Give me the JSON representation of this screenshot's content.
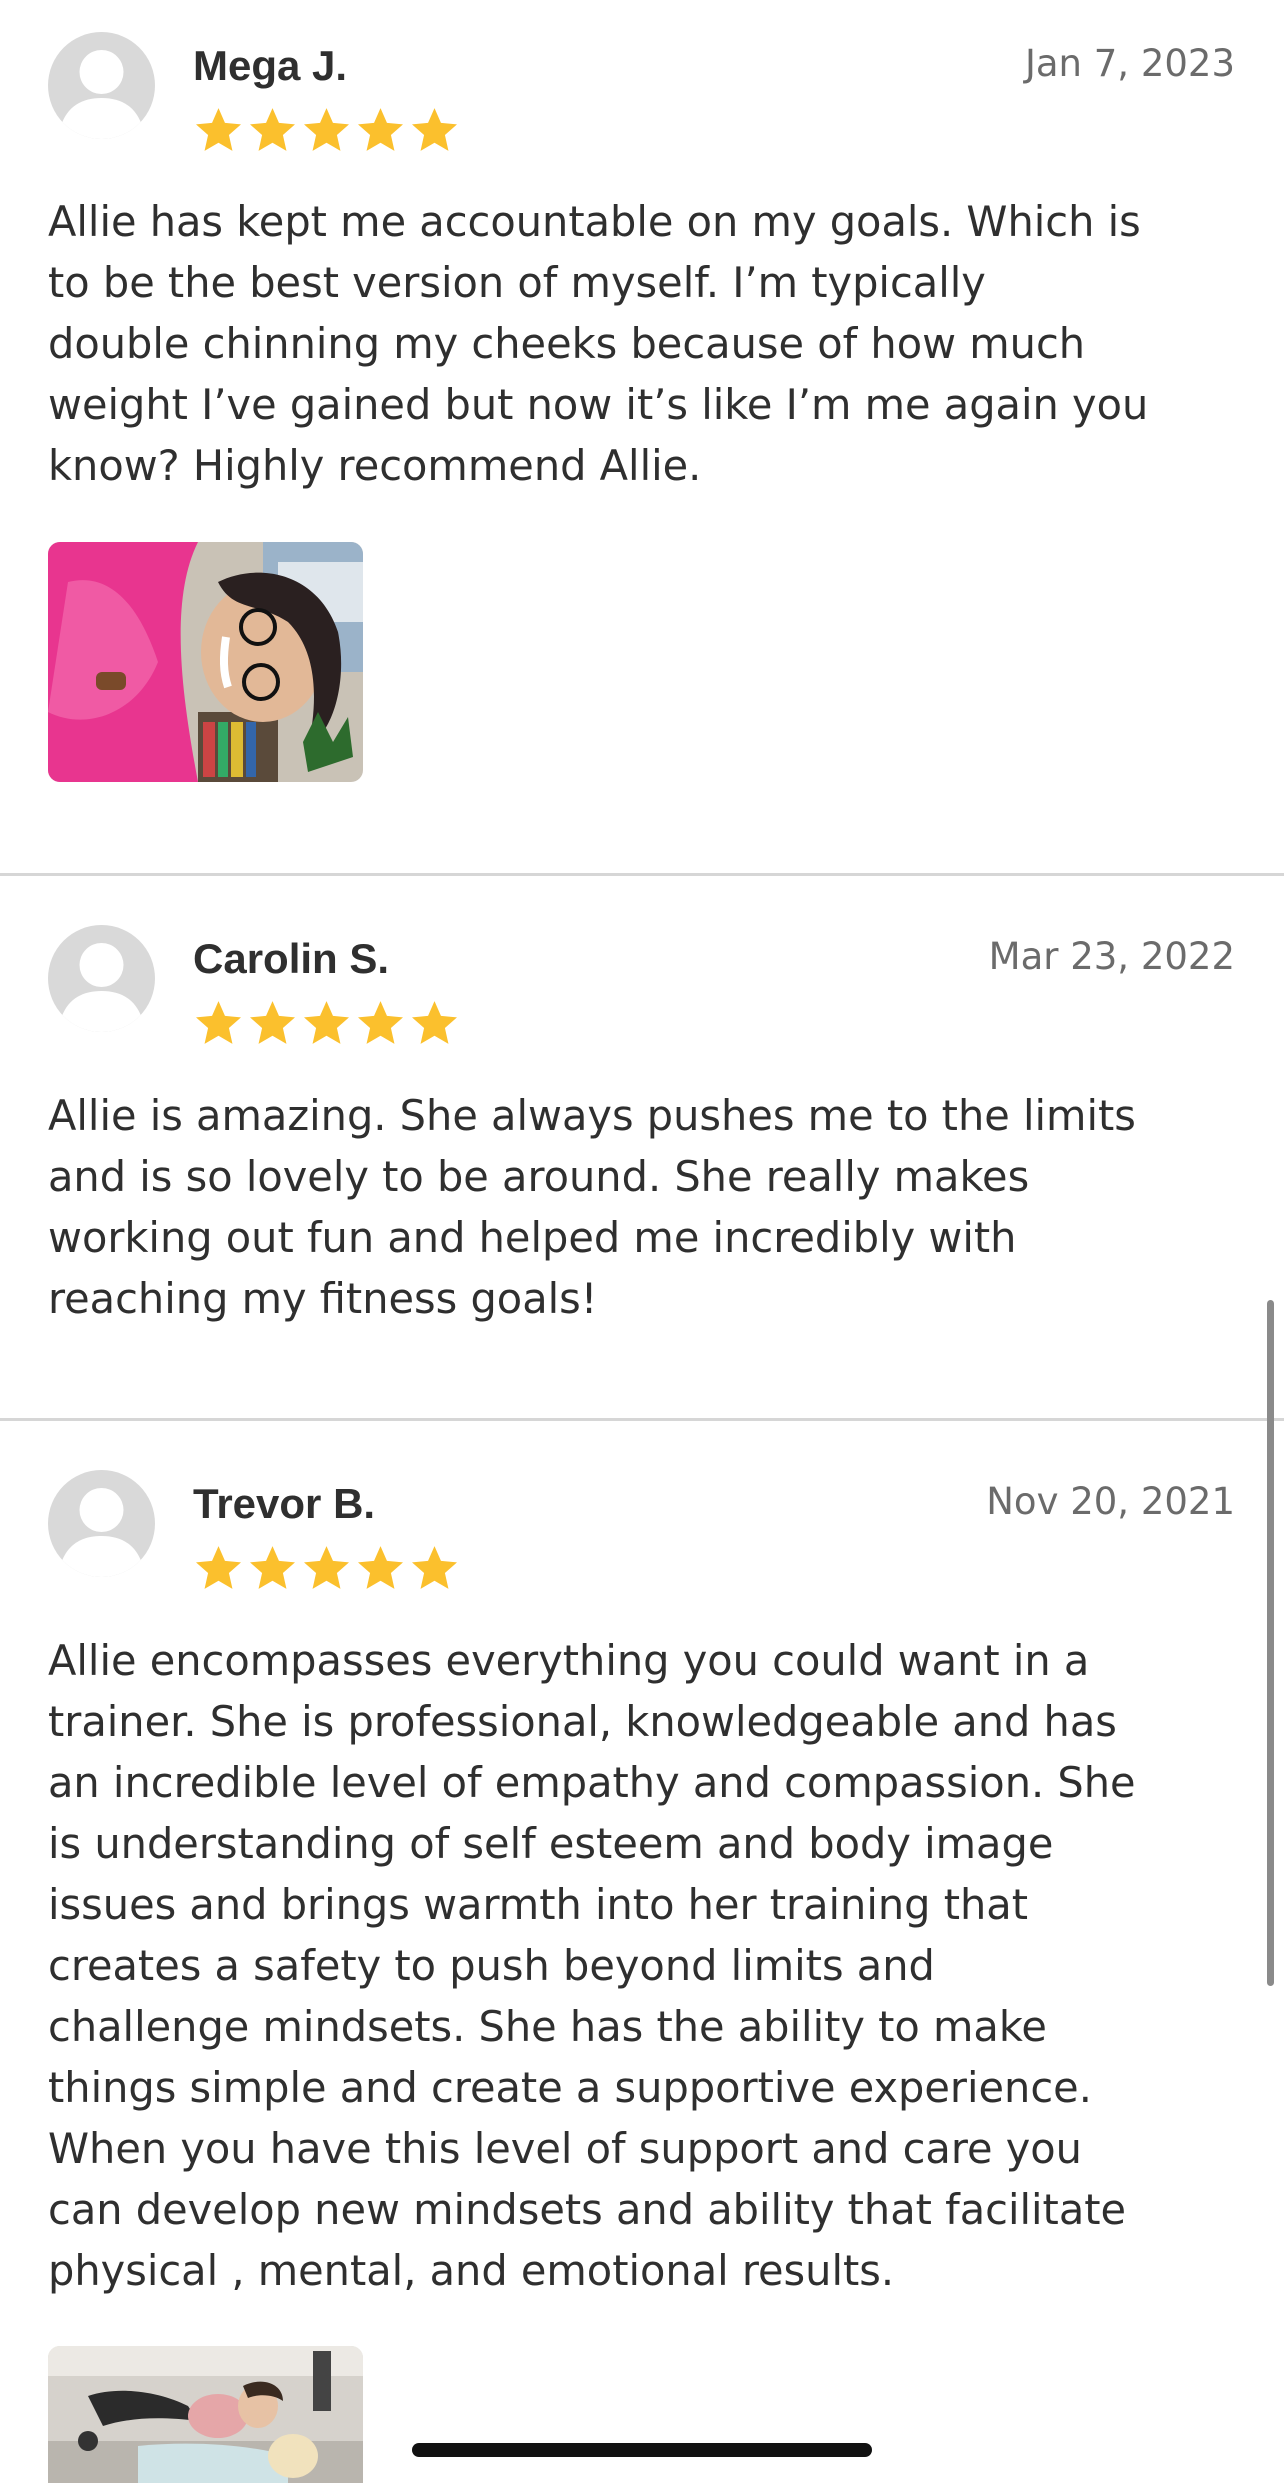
{
  "colors": {
    "star": "#FBC02D",
    "avatar_bg": "#d9d9d9",
    "divider": "#d6d6d6",
    "text": "#2f2f2f",
    "date": "#6b6b6b"
  },
  "reviews": [
    {
      "name": "Mega J.",
      "date": "Jan 7, 2023",
      "rating": 5,
      "text": "Allie has kept me accountable on my goals. Which is\nto be the best version of myself. I’m typically\ndouble chinning my cheeks because of how much\nweight I’ve gained but now it’s like I’m me again you\nknow? Highly recommend Allie.",
      "photo": "review-photo-woman-pink-top"
    },
    {
      "name": "Carolin S.",
      "date": "Mar 23, 2022",
      "rating": 5,
      "text": "Allie is amazing. She always pushes me to the limits\nand is so lovely to be around. She really makes\nworking out fun and helped me incredibly with\nreaching my fitness goals!"
    },
    {
      "name": "Trevor B.",
      "date": "Nov 20, 2021",
      "rating": 5,
      "text": "Allie encompasses everything you could want in a\ntrainer. She is professional, knowledgeable and has\nan incredible level of empathy and compassion. She\nis understanding of self esteem  and body image\nissues and brings warmth into her training that\ncreates a safety to push beyond limits and\nchallenge mindsets. She has the ability to make\nthings simple and create a supportive experience.\nWhen you have this level of support and care you\ncan develop new mindsets and ability that facilitate\nphysical , mental, and emotional results.",
      "photo": "review-photo-gym"
    }
  ]
}
